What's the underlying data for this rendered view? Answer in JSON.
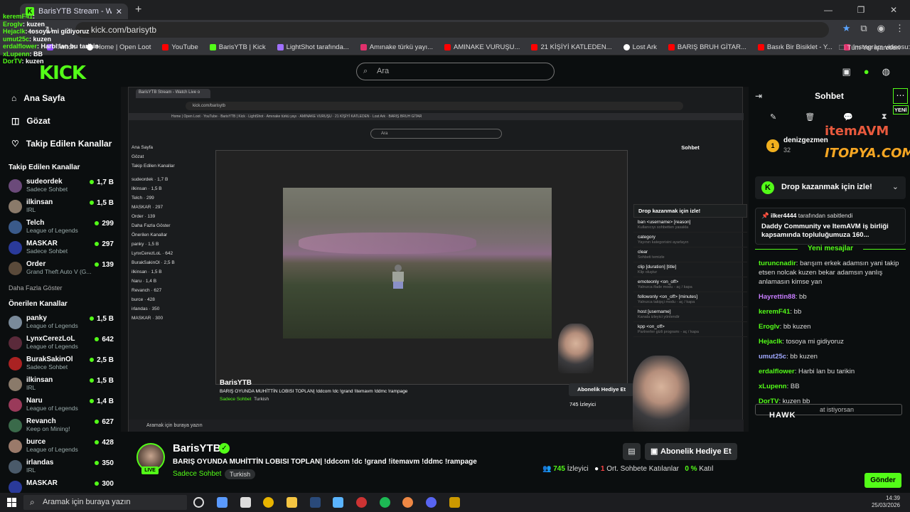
{
  "browser": {
    "tab_title": "BarisYTB Stream - Watch Live o",
    "url": "kick.com/barisytb",
    "bookmarks": [
      "Twitch",
      "Home | Open Loot",
      "YouTube",
      "BarisYTB | Kick",
      "LightShot tarafında...",
      "Amınake türkü yayı...",
      "AMINAKE VURUŞU...",
      "21 KİŞİYİ KATLEDEN...",
      "Lost Ark",
      "BARIŞ BRUH GİTAR...",
      "Basık Bir Bisiklet - Y...",
      "Instagram videosu:..."
    ],
    "bookmarks_right": "Tüm Yer İşaretleri"
  },
  "overlay_chat": [
    {
      "user": "keremF41",
      "msg": ":"
    },
    {
      "user": "Eroglv",
      "msg": ": kuzen"
    },
    {
      "user": "Hejaclk",
      "msg": ": tosoya mi gidiyoruz"
    },
    {
      "user": "umut25c",
      "msg": ": kuzen"
    },
    {
      "user": "erdalflower",
      "msg": ": Harbi lan bu tarikin"
    },
    {
      "user": "xLupenn",
      "msg": ": BB"
    },
    {
      "user": "DorTV",
      "msg": ": kuzen"
    }
  ],
  "header": {
    "logo": "KICK",
    "search_placeholder": "Ara"
  },
  "sidebar": {
    "nav": [
      "Ana Sayfa",
      "Gözat",
      "Takip Edilen Kanallar"
    ],
    "followed_title": "Takip Edilen Kanallar",
    "followed": [
      {
        "name": "sudeordek",
        "game": "Sadece Sohbet",
        "viewers": "1,7 B",
        "color": "#6b4a7a"
      },
      {
        "name": "ilkinsan",
        "game": "IRL",
        "viewers": "1,5 B",
        "color": "#8a7a6a"
      },
      {
        "name": "Telch",
        "game": "League of Legends",
        "viewers": "299",
        "color": "#3a5a8a"
      },
      {
        "name": "MASKAR",
        "game": "Sadece Sohbet",
        "viewers": "297",
        "color": "#2a3a9a"
      },
      {
        "name": "Order",
        "game": "Grand Theft Auto V (G...",
        "viewers": "139",
        "color": "#5a4a3a"
      }
    ],
    "more": "Daha Fazla Göster",
    "recommended_title": "Önerilen Kanallar",
    "recommended": [
      {
        "name": "panky",
        "game": "League of Legends",
        "viewers": "1,5 B",
        "color": "#7a8a9a"
      },
      {
        "name": "LynxCerezLoL",
        "game": "League of Legends",
        "viewers": "642",
        "color": "#5a2a3a"
      },
      {
        "name": "BurakSakinOl",
        "game": "Sadece Sohbet",
        "viewers": "2,5 B",
        "color": "#aa2222"
      },
      {
        "name": "ilkinsan",
        "game": "IRL",
        "viewers": "1,5 B",
        "color": "#8a7a6a"
      },
      {
        "name": "Naru",
        "game": "League of Legends",
        "viewers": "1,4 B",
        "color": "#9a3a5a"
      },
      {
        "name": "Revanch",
        "game": "Keep on Mining!",
        "viewers": "627",
        "color": "#3a6a4a"
      },
      {
        "name": "burce",
        "game": "League of Legends",
        "viewers": "428",
        "color": "#9a7a6a"
      },
      {
        "name": "irlandas",
        "game": "IRL",
        "viewers": "350",
        "color": "#4a5a6a"
      },
      {
        "name": "MASKAR",
        "game": "",
        "viewers": "300",
        "color": "#2a3a9a"
      }
    ]
  },
  "inner": {
    "title": "BarisYTB Stream - Watch Live o",
    "url": "kick.com/barisytb",
    "search": "Ara",
    "chat_title": "Sohbet",
    "drop": "Drop kazanmak için izle!",
    "commands": [
      {
        "name": "ban <username> [reason]",
        "desc": "Kullanıcıyı sohbetten yasakla"
      },
      {
        "name": "category",
        "desc": "Yayının kategorisini ayarlayın"
      },
      {
        "name": "clear",
        "desc": "Sohbeti temizle"
      },
      {
        "name": "clip [duration] [title]",
        "desc": "Klip oluştur"
      },
      {
        "name": "emoteonly <on_off>",
        "desc": "Yalnızca ifade modu - aç / kapa"
      },
      {
        "name": "followonly <on_off> [minutes]",
        "desc": "Yalnızca takipçi modu - aç / kapa"
      },
      {
        "name": "host [username]",
        "desc": "Kanala izleyici yönlendir"
      },
      {
        "name": "kpp <on_off>",
        "desc": "Partnerler gizli programı - aç / kapa"
      }
    ],
    "streamer": "BarisYTB",
    "stream_title": "BARIŞ OYUNDA MUHİTTİN LOBISI TOPLAN| !ddcom !dc !grand !itemavm !ddmc !rampage",
    "category": "Sadece Sohbet",
    "language": "Turkish",
    "subscribe": "Abonelik Hediye Et",
    "viewers": "745 İzleyici",
    "taskbar_search": "Aramak için buraya yazın"
  },
  "stream": {
    "streamer": "BarisYTB",
    "live": "LIVE",
    "title": "BARIŞ OYUNDA MUHİTTİN  LOBISI TOPLAN| !ddcom !dc !grand !itemavm !ddmc !rampage",
    "category": "Sadece Sohbet",
    "language": "Turkish",
    "subscribe": "Abonelik Hediye Et",
    "viewers_count": "745",
    "viewers_label": "İzleyici",
    "chatters_count": "1",
    "chatters_label": "Ort. Sohbete Katılanlar",
    "percent": "0 %",
    "percent_label": "Katıl"
  },
  "chat": {
    "title": "Sohbet",
    "new_badge": "YENİ",
    "top_user": "denizgezmen",
    "top_user_count": "32",
    "sponsor1": "itemAVM",
    "sponsor2": "ITOPYA.COM",
    "drop": "Drop kazanmak için izle!",
    "pinned_by": "ilker4444",
    "pinned_by_suffix": "tarafından sabitlendi",
    "pinned_msg": "Daddy Community ve ItemAVM iş birliği kapsamında topluluğumuza 160...",
    "new_messages": "Yeni mesajlar",
    "messages": [
      {
        "user": "turuncnadir",
        "color": "#53fc18",
        "text": "barışım erkek adamsın yani takip etsen nolcak kuzen bekar adamsın yanlış anlamasın kimse yan"
      },
      {
        "user": "Hayrettin88",
        "color": "#c77dff",
        "text": "bb"
      },
      {
        "user": "keremF41",
        "color": "#53fc18",
        "text": "bb"
      },
      {
        "user": "Eroglv",
        "color": "#53fc18",
        "text": "bb kuzen"
      },
      {
        "user": "Hejaclk",
        "color": "#53fc18",
        "text": "tosoya mi gidiyoruz"
      },
      {
        "user": "umut25c",
        "color": "#a0a8ff",
        "text": "bb kuzen"
      },
      {
        "user": "erdalflower",
        "color": "#53fc18",
        "text": "Harbi lan bu tarikin"
      },
      {
        "user": "xLupenn",
        "color": "#53fc18",
        "text": "BB"
      },
      {
        "user": "DorTV",
        "color": "#53fc18",
        "text": "kuzen bb"
      }
    ],
    "input_placeholder": "at istiyorsan",
    "send": "Gönder",
    "hawk": "HAWK"
  },
  "taskbar": {
    "search": "Aramak için buraya yazın",
    "time": "14:39",
    "date": "25/03/2026"
  }
}
